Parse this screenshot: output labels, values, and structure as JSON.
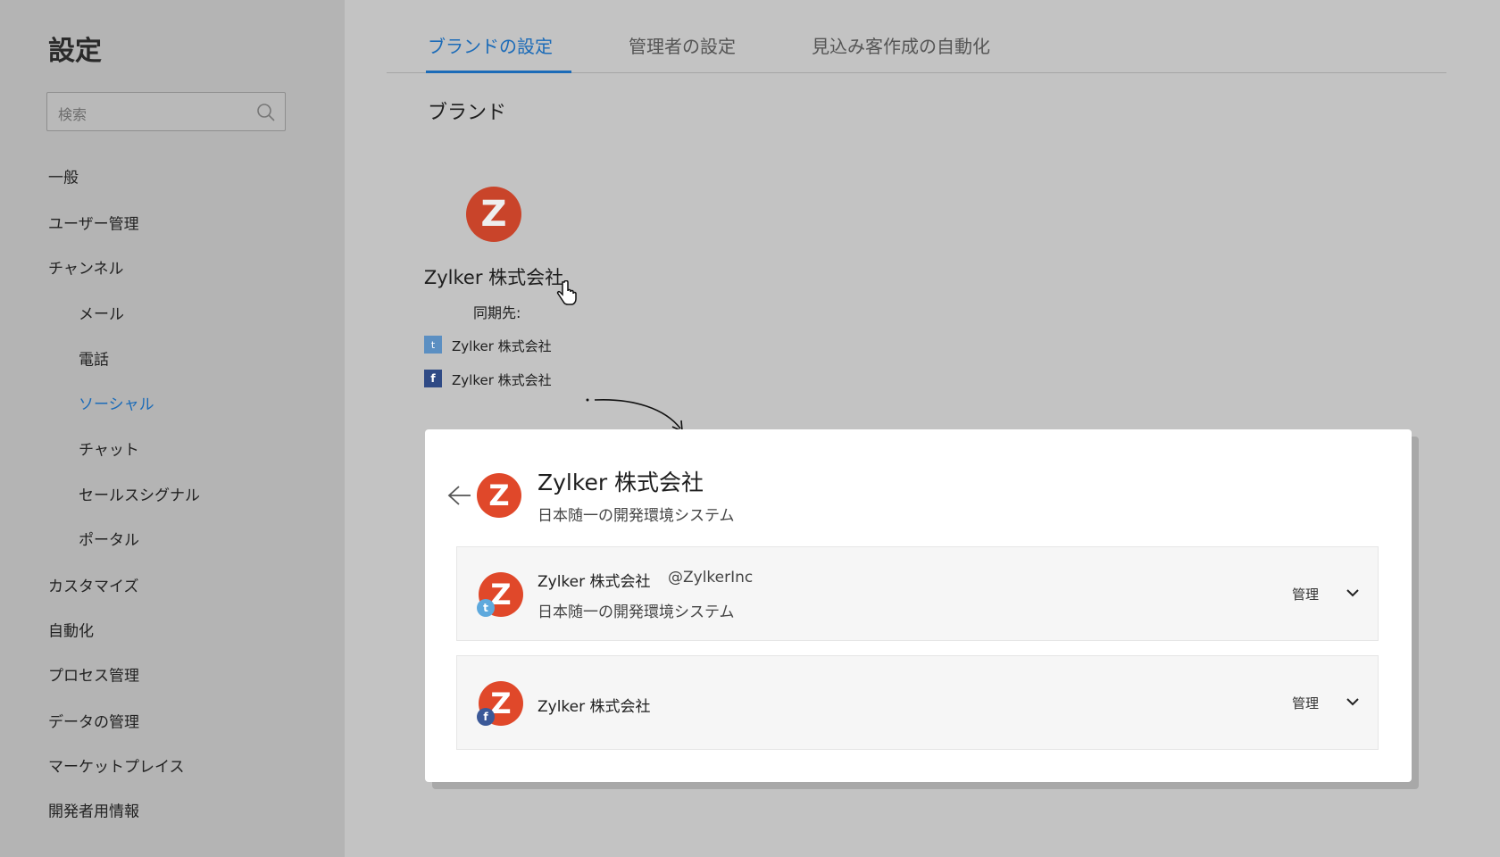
{
  "sidebar": {
    "title": "設定",
    "search_placeholder": "検索",
    "items": [
      {
        "label": "一般"
      },
      {
        "label": "ユーザー管理"
      },
      {
        "label": "チャンネル"
      },
      {
        "label": "メール"
      },
      {
        "label": "電話"
      },
      {
        "label": "ソーシャル"
      },
      {
        "label": "チャット"
      },
      {
        "label": "セールスシグナル"
      },
      {
        "label": "ポータル"
      },
      {
        "label": "カスタマイズ"
      },
      {
        "label": "自動化"
      },
      {
        "label": "プロセス管理"
      },
      {
        "label": "データの管理"
      },
      {
        "label": "マーケットプレイス"
      },
      {
        "label": "開発者用情報"
      }
    ]
  },
  "tabs": [
    {
      "label": "ブランドの設定"
    },
    {
      "label": "管理者の設定"
    },
    {
      "label": "見込み客作成の自動化"
    }
  ],
  "brand": {
    "heading": "ブランド",
    "name": "Zylker 株式会社",
    "sync_label": "同期先:",
    "twitter": "Zylker 株式会社",
    "facebook": "Zylker 株式会社"
  },
  "card": {
    "title": "Zylker 株式会社",
    "subtitle": "日本随一の開発環境システム",
    "rows": [
      {
        "name": "Zylker  株式会社",
        "handle": "@ZylkerInc",
        "desc": "日本随一の開発環境システム",
        "action": "管理"
      },
      {
        "name": "Zylker  株式会社",
        "action": "管理"
      }
    ]
  },
  "colors": {
    "accent": "#1b6bb8",
    "brand": "#e0482a",
    "twitter": "#5b9bd5",
    "facebook": "#3b5998"
  }
}
